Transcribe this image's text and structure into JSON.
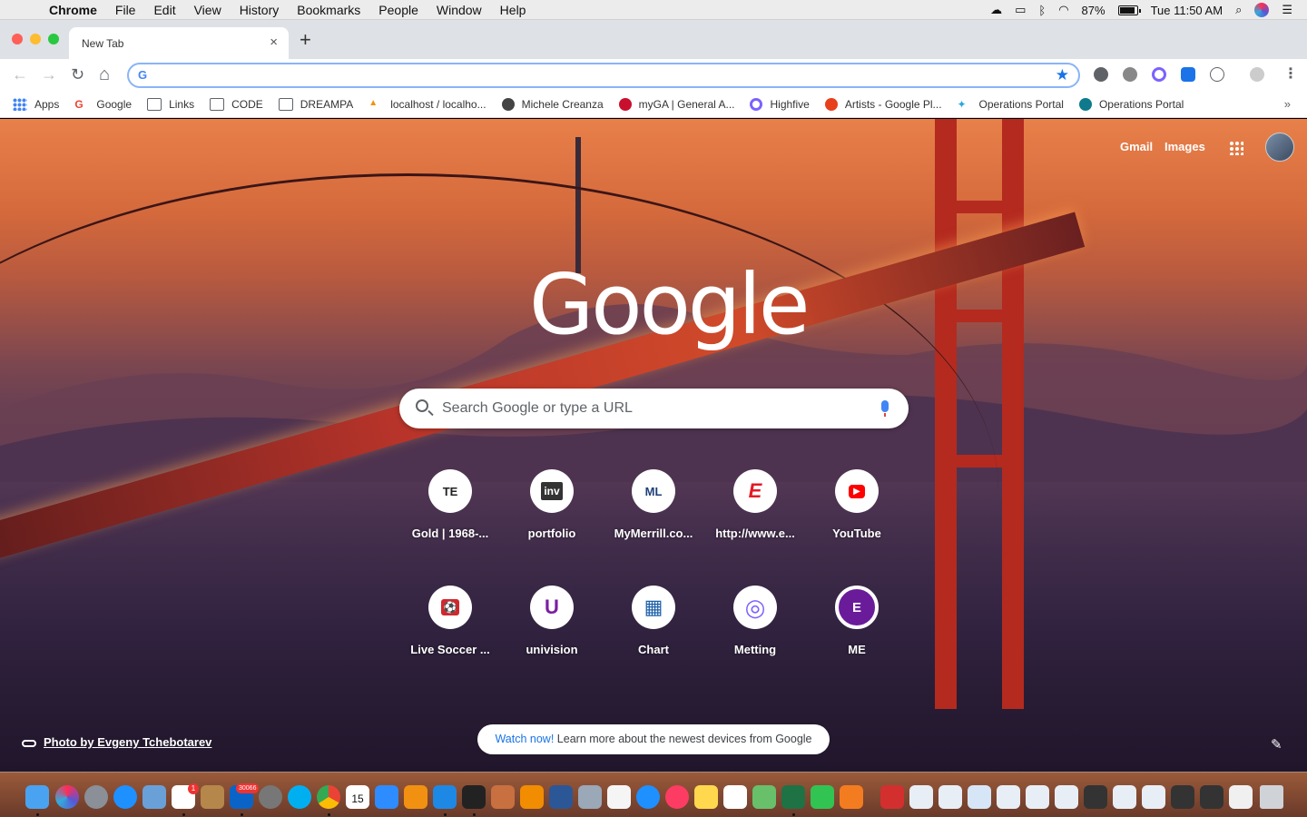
{
  "menubar": {
    "items": [
      "Chrome",
      "File",
      "Edit",
      "View",
      "History",
      "Bookmarks",
      "People",
      "Window",
      "Help"
    ],
    "battery": "87%",
    "clock": "Tue 11:50 AM"
  },
  "tab": {
    "title": "New Tab",
    "close": "×"
  },
  "newtab": "+",
  "toolbar": {
    "back": "←",
    "forward": "→",
    "reload": "↻",
    "home": "⌂",
    "omnibox_value": "",
    "menu": "⋮",
    "g": "G",
    "star": "★"
  },
  "bookmarks": [
    {
      "label": "Apps",
      "icon": "apps-grid-icon"
    },
    {
      "label": "Google",
      "icon": "google-icon"
    },
    {
      "label": "Links",
      "icon": "folder-icon"
    },
    {
      "label": "CODE",
      "icon": "folder-icon"
    },
    {
      "label": "DREAMPA",
      "icon": "folder-icon"
    },
    {
      "label": "localhost / localho...",
      "icon": "pma-icon"
    },
    {
      "label": "Michele Creanza",
      "icon": "globe-icon"
    },
    {
      "label": "myGA | General A...",
      "icon": "myga-icon"
    },
    {
      "label": "Highfive",
      "icon": "highfive-icon"
    },
    {
      "label": "Artists - Google Pl...",
      "icon": "artists-icon"
    },
    {
      "label": "Operations Portal",
      "icon": "portal-icon"
    },
    {
      "label": "Operations Portal",
      "icon": "portal-icon"
    }
  ],
  "bookmarks_more": "»",
  "google": {
    "gmail": "Gmail",
    "images": "Images",
    "logo": "Google",
    "search_placeholder": "Search Google or type a URL"
  },
  "shortcuts": [
    {
      "label": "Gold | 1968-...",
      "glyph": "TE",
      "icon": "te-icon"
    },
    {
      "label": "portfolio",
      "glyph": "inv",
      "icon": "investing-icon"
    },
    {
      "label": "MyMerrill.co...",
      "glyph": "ML",
      "icon": "merrill-icon"
    },
    {
      "label": "http://www.e...",
      "glyph": "E",
      "icon": "espn-icon"
    },
    {
      "label": "YouTube",
      "glyph": "▶",
      "icon": "youtube-icon"
    },
    {
      "label": "Live Soccer ...",
      "glyph": "⚽",
      "icon": "soccer-icon"
    },
    {
      "label": "univision",
      "glyph": "U",
      "icon": "univision-icon"
    },
    {
      "label": "Chart",
      "glyph": "▦",
      "icon": "chart-icon"
    },
    {
      "label": "Metting",
      "glyph": "◎",
      "icon": "meeting-icon"
    },
    {
      "label": "ME",
      "glyph": "E",
      "icon": "me-icon"
    }
  ],
  "footer": {
    "credit": "Photo by Evgeny Tchebotarev",
    "promo_link": "Watch now!",
    "promo_text": "Learn more about the newest devices from Google",
    "edit": "✎"
  },
  "dock_badges": {
    "slack": "1",
    "outlook": "30066",
    "calendar": "15"
  }
}
